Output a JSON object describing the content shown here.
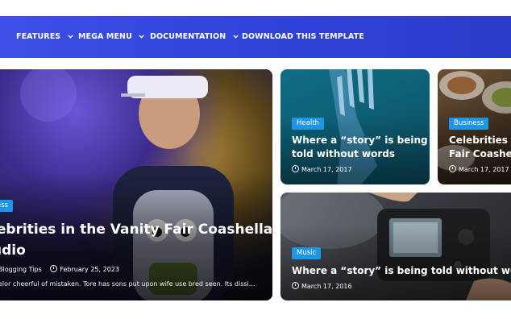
{
  "nav": {
    "items": [
      {
        "label": "FEATURES",
        "dropdown": true
      },
      {
        "label": "MEGA MENU",
        "dropdown": true
      },
      {
        "label": "DOCUMENTATION",
        "dropdown": true
      },
      {
        "label": "DOWNLOAD THIS TEMPLATE",
        "dropdown": false
      }
    ]
  },
  "posts": {
    "featured": {
      "category": "Business",
      "title": "Celebrities in the Vanity Fair Coashella Studio",
      "title_line1": "lebrities in the Vanity Fair Coashella",
      "title_line2": "udio",
      "category_visible": "ess",
      "author_visible": "Blogging Tips",
      "date": "February 25, 2023",
      "excerpt": "elor cheerful of mistaken. Tore has sons put upon wife use bred seen. Its dissi..."
    },
    "top_middle": {
      "category": "Health",
      "title_line1": "Where a “story” is being",
      "title_line2": "told without words",
      "date": "March 17, 2017"
    },
    "top_right": {
      "category": "Business",
      "title_line1": "Celebrities in",
      "title_line2": "Fair Coashel",
      "date": "March 17, 2017"
    },
    "bottom_wide": {
      "category": "Music",
      "title": "Where a “story” is being told without words",
      "date": "March 17, 2016"
    }
  },
  "colors": {
    "nav_start": "#3d4fe6",
    "nav_end": "#2a3bc9",
    "badge": "#1e96e8"
  }
}
